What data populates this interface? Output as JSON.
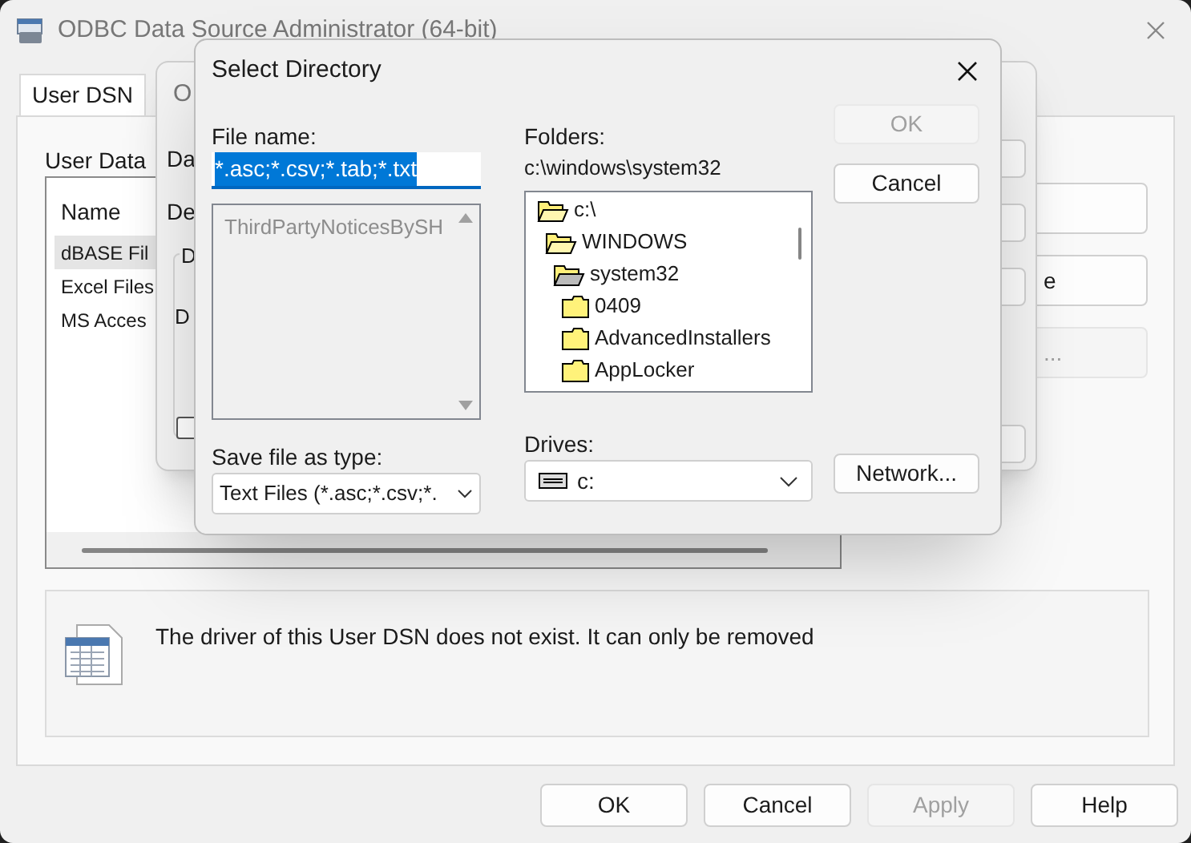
{
  "main_window": {
    "title": "ODBC Data Source Administrator (64-bit)",
    "tabs": [
      {
        "label": "User DSN",
        "selected": true
      }
    ],
    "panel_label": "User Data",
    "list": {
      "column": "Name",
      "rows": [
        {
          "name": "dBASE Fil",
          "selected": true
        },
        {
          "name": "Excel Files",
          "selected": false
        },
        {
          "name": "MS Acces",
          "selected": false
        }
      ]
    },
    "side_buttons": [
      {
        "kind": "blank",
        "disabled": false
      },
      {
        "kind": "text",
        "label": "e",
        "disabled": false
      },
      {
        "kind": "text",
        "label": "...",
        "disabled": true
      }
    ],
    "info": "The driver of this User DSN does not exist. It can only be removed",
    "buttons": [
      {
        "label": "OK",
        "disabled": false
      },
      {
        "label": "Cancel",
        "disabled": false
      },
      {
        "label": "Apply",
        "disabled": true
      },
      {
        "label": "Help",
        "disabled": false
      }
    ]
  },
  "setup_dialog": {
    "title": "O",
    "labels": [
      "Da",
      "De"
    ],
    "group_label": "D",
    "group_text": "D",
    "checkbox": {
      "checked": false
    }
  },
  "select_dialog": {
    "title": "Select Directory",
    "file_name_label": "File name:",
    "file_name": {
      "value": "*.asc;*.csv;*.tab;*.txt",
      "selected": true
    },
    "files": [
      {
        "name": "ThirdPartyNoticesBySH",
        "disabled": true
      }
    ],
    "folders_label": "Folders:",
    "path": "c:\\windows\\system32",
    "folders": [
      {
        "name": "c:\\",
        "expanded": true,
        "children": [
          {
            "name": "WINDOWS",
            "expanded": true,
            "children": [
              {
                "name": "system32",
                "expanded": true,
                "current": true,
                "children": [
                  {
                    "name": "0409",
                    "expanded": false
                  },
                  {
                    "name": "AdvancedInstallers",
                    "expanded": false
                  },
                  {
                    "name": "AppLocker",
                    "expanded": false
                  }
                ]
              }
            ]
          }
        ]
      }
    ],
    "type_label": "Save file as type:",
    "type_value": "Text Files (*.asc;*.csv;*.",
    "drives_label": "Drives:",
    "drive_value": "c:",
    "buttons": [
      {
        "kind": "ok",
        "label": "OK",
        "disabled": true
      },
      {
        "kind": "cancel",
        "label": "Cancel",
        "disabled": false
      },
      {
        "kind": "network",
        "label": "Network...",
        "disabled": false
      }
    ]
  }
}
